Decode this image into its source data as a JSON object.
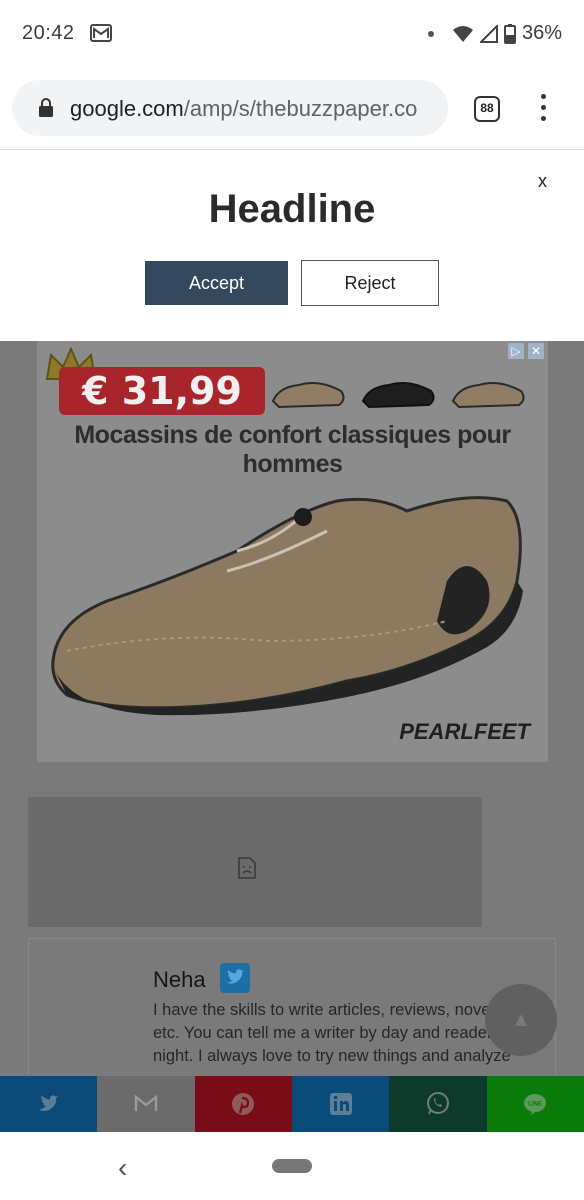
{
  "status_bar": {
    "time": "20:42",
    "battery": "36%"
  },
  "browser": {
    "url_host": "google.com",
    "url_path": "/amp/s/thebuzzpaper.co",
    "tab_count": "88"
  },
  "consent": {
    "close_label": "x",
    "title": "Headline",
    "accept_label": "Accept",
    "reject_label": "Reject"
  },
  "ad": {
    "price": "€ 31,99",
    "title": "Mocassins de confort classiques pour hommes",
    "brand": "PEARLFEET"
  },
  "author": {
    "name": "Neha",
    "bio": "I have the skills to write articles, reviews, novels, etc. You can tell me a writer by day and reader by night. I always love to try new things and analyze"
  },
  "share_bar": {
    "items": [
      {
        "name": "twitter",
        "color": "#0b4a78"
      },
      {
        "name": "gmail",
        "color": "#6b6b6b"
      },
      {
        "name": "pinterest",
        "color": "#7a0c17"
      },
      {
        "name": "linkedin",
        "color": "#0a4c79"
      },
      {
        "name": "whatsapp",
        "color": "#0e3a2b"
      },
      {
        "name": "line",
        "color": "#0a7a0a"
      }
    ]
  },
  "colors": {
    "accept_bg": "#34495e",
    "overlay": "#7a7a7a"
  }
}
